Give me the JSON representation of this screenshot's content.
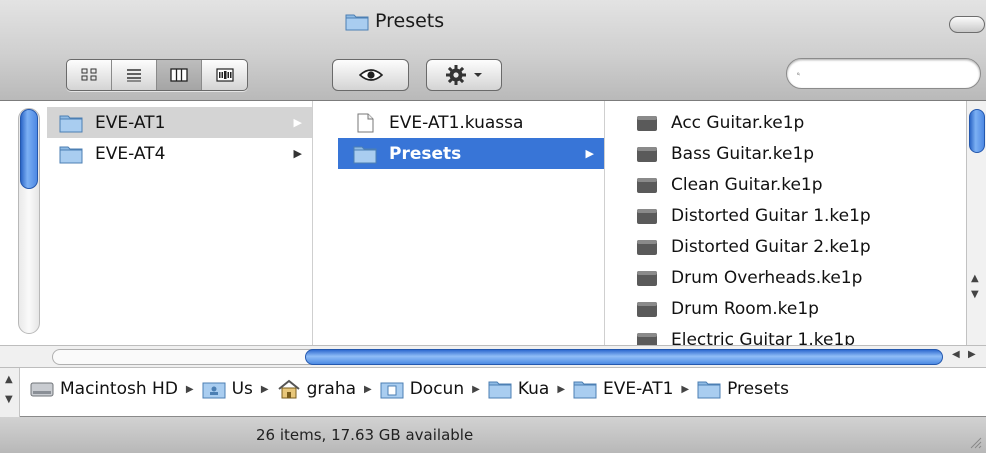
{
  "window": {
    "title": "Presets"
  },
  "toolbar": {
    "view_buttons": [
      {
        "name": "icon-view-icon",
        "active": false
      },
      {
        "name": "list-view-icon",
        "active": false
      },
      {
        "name": "column-view-icon",
        "active": true
      },
      {
        "name": "cover-flow-view-icon",
        "active": false
      }
    ],
    "quick_look_icon": "eye-icon",
    "action_icon": "gear-icon",
    "search": {
      "value": "",
      "placeholder": "",
      "icon": "search-icon"
    }
  },
  "columns": [
    {
      "items": [
        {
          "label": "EVE-AT1",
          "icon": "folder-icon",
          "has_children": true,
          "selected": "inactive"
        },
        {
          "label": "EVE-AT4",
          "icon": "folder-icon",
          "has_children": true,
          "selected": "none"
        }
      ]
    },
    {
      "items": [
        {
          "label": "EVE-AT1.kuassa",
          "icon": "document-icon",
          "has_children": false,
          "selected": "none"
        },
        {
          "label": "Presets",
          "icon": "folder-icon",
          "has_children": true,
          "selected": "active"
        }
      ]
    },
    {
      "items": [
        {
          "label": "Acc Guitar.ke1p",
          "icon": "file-icon"
        },
        {
          "label": "Bass Guitar.ke1p",
          "icon": "file-icon"
        },
        {
          "label": "Clean Guitar.ke1p",
          "icon": "file-icon"
        },
        {
          "label": "Distorted Guitar 1.ke1p",
          "icon": "file-icon"
        },
        {
          "label": "Distorted Guitar 2.ke1p",
          "icon": "file-icon"
        },
        {
          "label": "Drum Overheads.ke1p",
          "icon": "file-icon"
        },
        {
          "label": "Drum Room.ke1p",
          "icon": "file-icon"
        },
        {
          "label": "Electric Guitar 1.ke1p",
          "icon": "file-icon"
        }
      ]
    }
  ],
  "pathbar": {
    "crumbs": [
      {
        "label": "Macintosh HD",
        "icon": "hard-drive-icon"
      },
      {
        "label": "Us",
        "icon": "users-folder-icon"
      },
      {
        "label": "graha",
        "icon": "home-icon"
      },
      {
        "label": "Docun",
        "icon": "documents-folder-icon"
      },
      {
        "label": "Kua",
        "icon": "folder-icon"
      },
      {
        "label": "EVE-AT1",
        "icon": "folder-icon"
      },
      {
        "label": "Presets",
        "icon": "folder-icon"
      }
    ]
  },
  "status": {
    "text": "26 items, 17.63 GB available"
  },
  "colors": {
    "selection": "#3875d7",
    "selection_inactive": "#d4d4d4",
    "scroll_thumb": "#4e89e3"
  }
}
